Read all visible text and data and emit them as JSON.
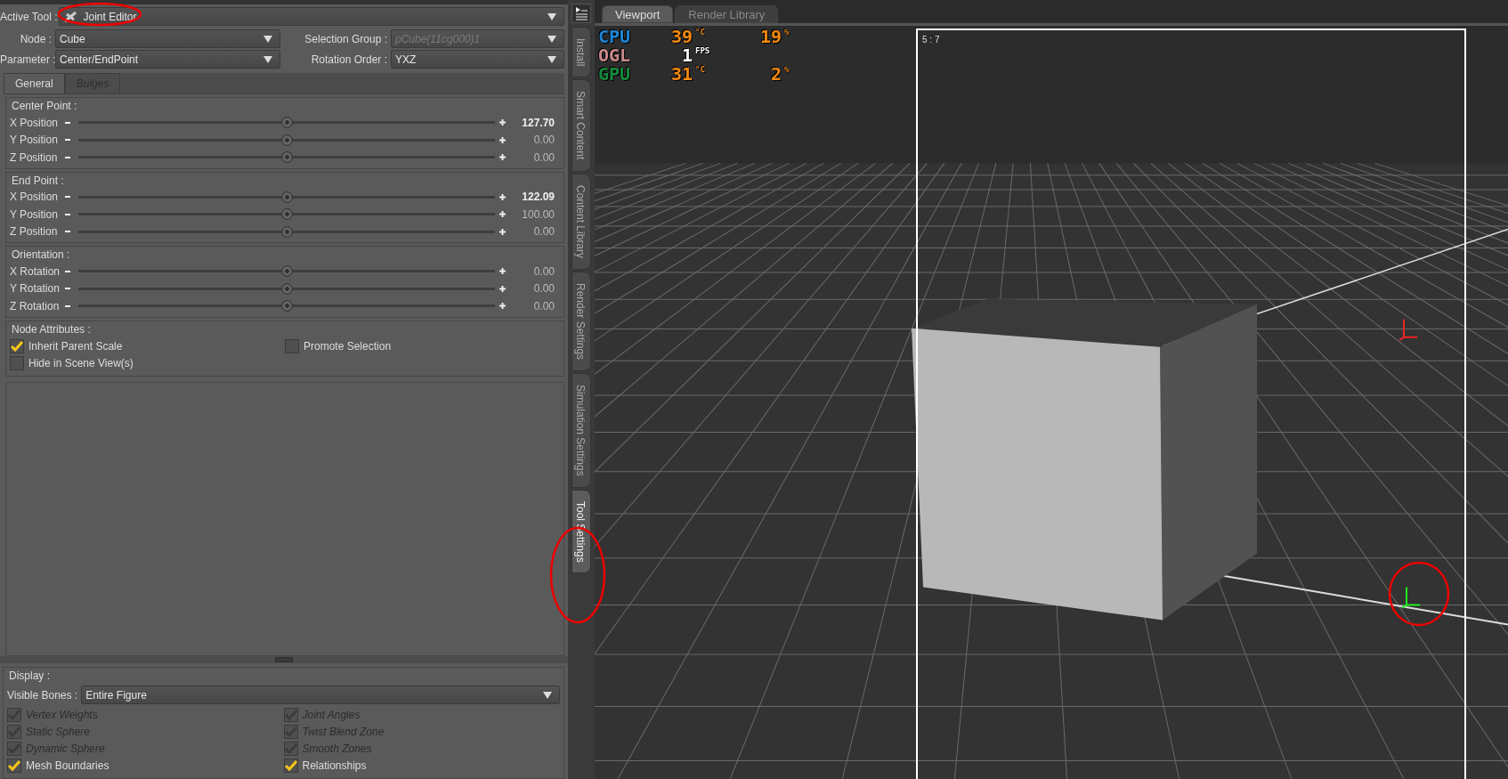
{
  "active_tool": {
    "label": "Active Tool :",
    "value": "Joint Editor"
  },
  "field_rows": [
    {
      "fields": [
        {
          "label": "Node :",
          "value": "Cube",
          "disabled": false
        },
        {
          "label": "Selection Group :",
          "value": "pCube(11cg000)1",
          "disabled": true
        }
      ]
    },
    {
      "fields": [
        {
          "label": "Parameter :",
          "value": "Center/EndPoint",
          "disabled": false
        },
        {
          "label": "Rotation Order :",
          "value": "YXZ",
          "disabled": false
        }
      ]
    }
  ],
  "tabs": [
    {
      "label": "General",
      "selected": true,
      "disabled": false
    },
    {
      "label": "Bulges",
      "selected": false,
      "disabled": true
    }
  ],
  "groups": [
    {
      "title": "Center Point :",
      "sliders": [
        {
          "label": "X Position",
          "level": 0.5,
          "value": "127.70",
          "modified": true
        },
        {
          "label": "Y Position",
          "level": 0.5,
          "value": "0.00",
          "modified": false
        },
        {
          "label": "Z Position",
          "level": 0.5,
          "value": "0.00",
          "modified": false
        }
      ]
    },
    {
      "title": "End Point :",
      "sliders": [
        {
          "label": "X Position",
          "level": 0.5,
          "value": "122.09",
          "modified": true
        },
        {
          "label": "Y Position",
          "level": 0.5,
          "value": "100.00",
          "modified": false
        },
        {
          "label": "Z Position",
          "level": 0.5,
          "value": "0.00",
          "modified": false
        }
      ]
    },
    {
      "title": "Orientation :",
      "sliders": [
        {
          "label": "X Rotation",
          "level": 0.5,
          "value": "0.00",
          "modified": false
        },
        {
          "label": "Y Rotation",
          "level": 0.5,
          "value": "0.00",
          "modified": false
        },
        {
          "label": "Z Rotation",
          "level": 0.5,
          "value": "0.00",
          "modified": false
        }
      ]
    }
  ],
  "node_attributes": {
    "title": "Node Attributes :",
    "options": [
      {
        "label": "Inherit Parent Scale",
        "checked": true
      },
      {
        "label": "Promote Selection",
        "checked": false
      },
      {
        "label": "Hide in Scene View(s)",
        "checked": false
      }
    ]
  },
  "display": {
    "title": "Display :",
    "visible_bones": {
      "label": "Visible Bones :",
      "value": "Entire Figure"
    },
    "options": [
      {
        "label": "Vertex Weights",
        "checked": true,
        "disabled": true
      },
      {
        "label": "Joint Angles",
        "checked": true,
        "disabled": true
      },
      {
        "label": "Static Sphere",
        "checked": true,
        "disabled": true
      },
      {
        "label": "Twist Blend Zone",
        "checked": true,
        "disabled": true
      },
      {
        "label": "Dynamic Sphere",
        "checked": true,
        "disabled": true
      },
      {
        "label": "Smooth Zones",
        "checked": true,
        "disabled": true
      },
      {
        "label": "Mesh Boundaries",
        "checked": true,
        "disabled": false
      },
      {
        "label": "Relationships",
        "checked": true,
        "disabled": false
      }
    ]
  },
  "side_tabs": [
    {
      "label": "Install",
      "selected": false
    },
    {
      "label": "Smart Content",
      "selected": false
    },
    {
      "label": "Content Library",
      "selected": false
    },
    {
      "label": "Render Settings",
      "selected": false
    },
    {
      "label": "Simulation Settings",
      "selected": false
    },
    {
      "label": "Tool Settings",
      "selected": true
    }
  ],
  "viewport": {
    "tabs": [
      {
        "label": "Viewport",
        "selected": true
      },
      {
        "label": "Render Library",
        "selected": false
      }
    ],
    "hud": [
      {
        "label": "CPU",
        "color": "#1f86d6",
        "kind": "sensor",
        "readings": [
          {
            "value": "39",
            "unit": "°C"
          },
          {
            "value": "19",
            "unit": "%"
          }
        ]
      },
      {
        "label": "OGL",
        "color": "#c98a8a",
        "kind": "counter",
        "readings": [
          {
            "value": "1",
            "unit": "FPS"
          }
        ]
      },
      {
        "label": "GPU",
        "color": "#168a3c",
        "kind": "sensor",
        "readings": [
          {
            "value": "31",
            "unit": "°C"
          },
          {
            "value": "2",
            "unit": "%"
          }
        ]
      }
    ],
    "frame_label": "5 : 7"
  }
}
